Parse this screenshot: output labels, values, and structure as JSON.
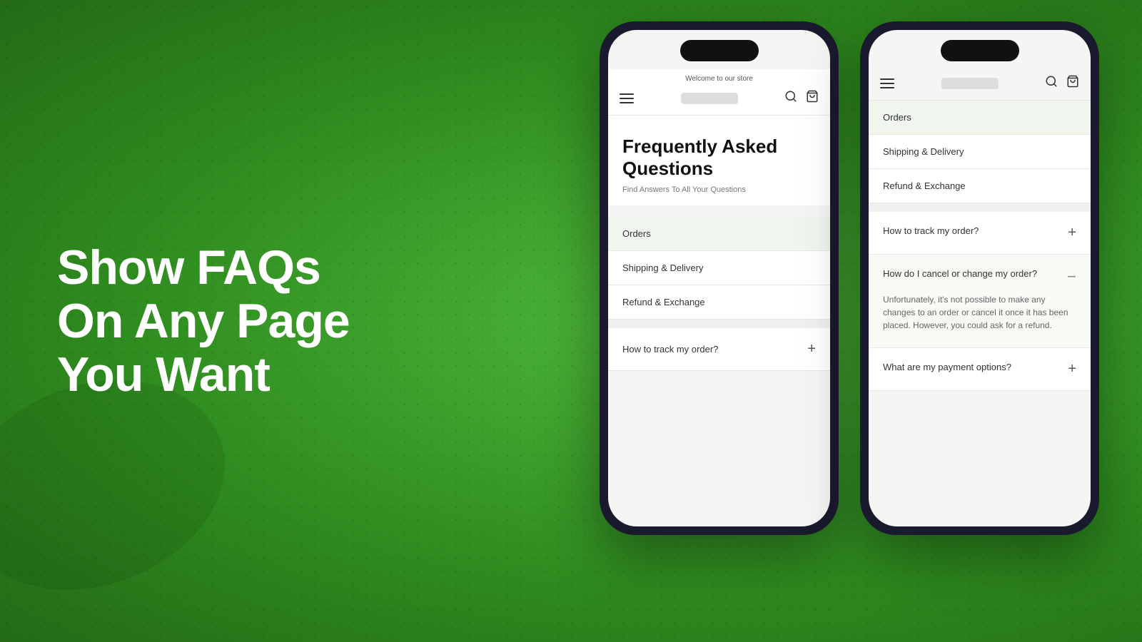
{
  "background": {
    "color_start": "#4db83a",
    "color_end": "#246a17"
  },
  "left_text": {
    "heading": "Show FAQs On Any Page You Want"
  },
  "phone1": {
    "welcome_bar": "Welcome to our store",
    "nav_logo": "",
    "faq_title": "Frequently Asked Questions",
    "faq_subtitle": "Find Answers To All Your Questions",
    "categories": [
      {
        "label": "Orders",
        "active": true
      },
      {
        "label": "Shipping & Delivery",
        "active": false
      },
      {
        "label": "Refund & Exchange",
        "active": false
      }
    ],
    "faq_items": [
      {
        "question": "How to track my order?",
        "expanded": false
      }
    ]
  },
  "phone2": {
    "nav_logo": "",
    "categories": [
      {
        "label": "Orders",
        "active": true
      },
      {
        "label": "Shipping & Delivery",
        "active": false
      },
      {
        "label": "Refund & Exchange",
        "active": false
      }
    ],
    "faq_items": [
      {
        "question": "How to track my order?",
        "expanded": false,
        "answer": ""
      },
      {
        "question": "How do I cancel or change my order?",
        "expanded": true,
        "answer": "Unfortunately, it's not possible to make any changes to an order or cancel it once it has been placed. However, you could ask for a refund."
      },
      {
        "question": "What are my payment options?",
        "expanded": false,
        "answer": ""
      }
    ]
  },
  "icons": {
    "hamburger": "☰",
    "search": "🔍",
    "cart": "🛍",
    "plus": "+",
    "minus": "−"
  }
}
